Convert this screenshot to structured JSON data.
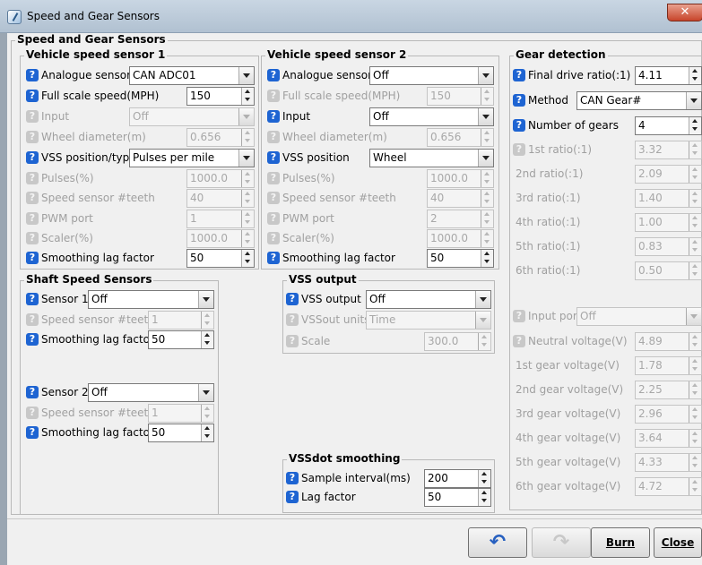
{
  "window": {
    "title": "Speed and Gear Sensors",
    "close_glyph": "✕"
  },
  "main_group": "Speed and Gear Sensors",
  "vss1": {
    "title": "Vehicle speed sensor 1",
    "rows": [
      {
        "label": "Analogue sensor",
        "value": "CAN ADC01"
      },
      {
        "label": "Full scale speed(MPH)",
        "value": "150"
      },
      {
        "label": "Input",
        "value": "Off"
      },
      {
        "label": "Wheel diameter(m)",
        "value": "0.656"
      },
      {
        "label": "VSS position/type",
        "value": "Pulses per mile"
      },
      {
        "label": "Pulses(%)",
        "value": "1000.0"
      },
      {
        "label": "Speed sensor #teeth",
        "value": "40"
      },
      {
        "label": "PWM port",
        "value": "1"
      },
      {
        "label": "Scaler(%)",
        "value": "1000.0"
      },
      {
        "label": "Smoothing lag factor",
        "value": "50"
      }
    ]
  },
  "vss2": {
    "title": "Vehicle speed sensor 2",
    "rows": [
      {
        "label": "Analogue sensor",
        "value": "Off"
      },
      {
        "label": "Full scale speed(MPH)",
        "value": "150"
      },
      {
        "label": "Input",
        "value": "Off"
      },
      {
        "label": "Wheel diameter(m)",
        "value": "0.656"
      },
      {
        "label": "VSS position",
        "value": "Wheel"
      },
      {
        "label": "Pulses(%)",
        "value": "1000.0"
      },
      {
        "label": "Speed sensor #teeth",
        "value": "40"
      },
      {
        "label": "PWM port",
        "value": "2"
      },
      {
        "label": "Scaler(%)",
        "value": "1000.0"
      },
      {
        "label": "Smoothing lag factor",
        "value": "50"
      }
    ]
  },
  "shaft": {
    "title": "Shaft Speed Sensors",
    "rows": [
      {
        "label": "Sensor 1",
        "value": "Off"
      },
      {
        "label": "Speed sensor #teeth",
        "value": "1"
      },
      {
        "label": "Smoothing lag factor",
        "value": "50"
      },
      {
        "label": "Sensor 2",
        "value": "Off"
      },
      {
        "label": "Speed sensor #teeth",
        "value": "1"
      },
      {
        "label": "Smoothing lag factor",
        "value": "50"
      }
    ]
  },
  "vss_output": {
    "title": "VSS output",
    "rows": [
      {
        "label": "VSS output",
        "value": "Off"
      },
      {
        "label": "VSSout units",
        "value": "Time"
      },
      {
        "label": "Scale",
        "value": "300.0"
      }
    ]
  },
  "vssdot": {
    "title": "VSSdot smoothing",
    "rows": [
      {
        "label": "Sample interval(ms)",
        "value": "200"
      },
      {
        "label": "Lag factor",
        "value": "50"
      }
    ]
  },
  "gear": {
    "title": "Gear detection",
    "rows": [
      {
        "label": "Final drive ratio(:1)",
        "value": "4.11"
      },
      {
        "label": "Method",
        "value": "CAN Gear#"
      },
      {
        "label": "Number of gears",
        "value": "4"
      },
      {
        "label": "1st ratio(:1)",
        "value": "3.32"
      },
      {
        "label": "2nd ratio(:1)",
        "value": "2.09"
      },
      {
        "label": "3rd ratio(:1)",
        "value": "1.40"
      },
      {
        "label": "4th ratio(:1)",
        "value": "1.00"
      },
      {
        "label": "5th ratio(:1)",
        "value": "0.83"
      },
      {
        "label": "6th ratio(:1)",
        "value": "0.50"
      },
      {
        "label": "Input port",
        "value": "Off"
      },
      {
        "label": "Neutral voltage(V)",
        "value": "4.89"
      },
      {
        "label": "1st gear voltage(V)",
        "value": "1.78"
      },
      {
        "label": "2nd gear voltage(V)",
        "value": "2.25"
      },
      {
        "label": "3rd gear voltage(V)",
        "value": "2.96"
      },
      {
        "label": "4th gear voltage(V)",
        "value": "3.64"
      },
      {
        "label": "5th gear voltage(V)",
        "value": "4.33"
      },
      {
        "label": "6th gear voltage(V)",
        "value": "4.72"
      }
    ]
  },
  "buttons": {
    "help_glyph": "?",
    "undo_glyph": "↶",
    "redo_glyph": "↷",
    "burn": "Burn",
    "close": "Close"
  }
}
